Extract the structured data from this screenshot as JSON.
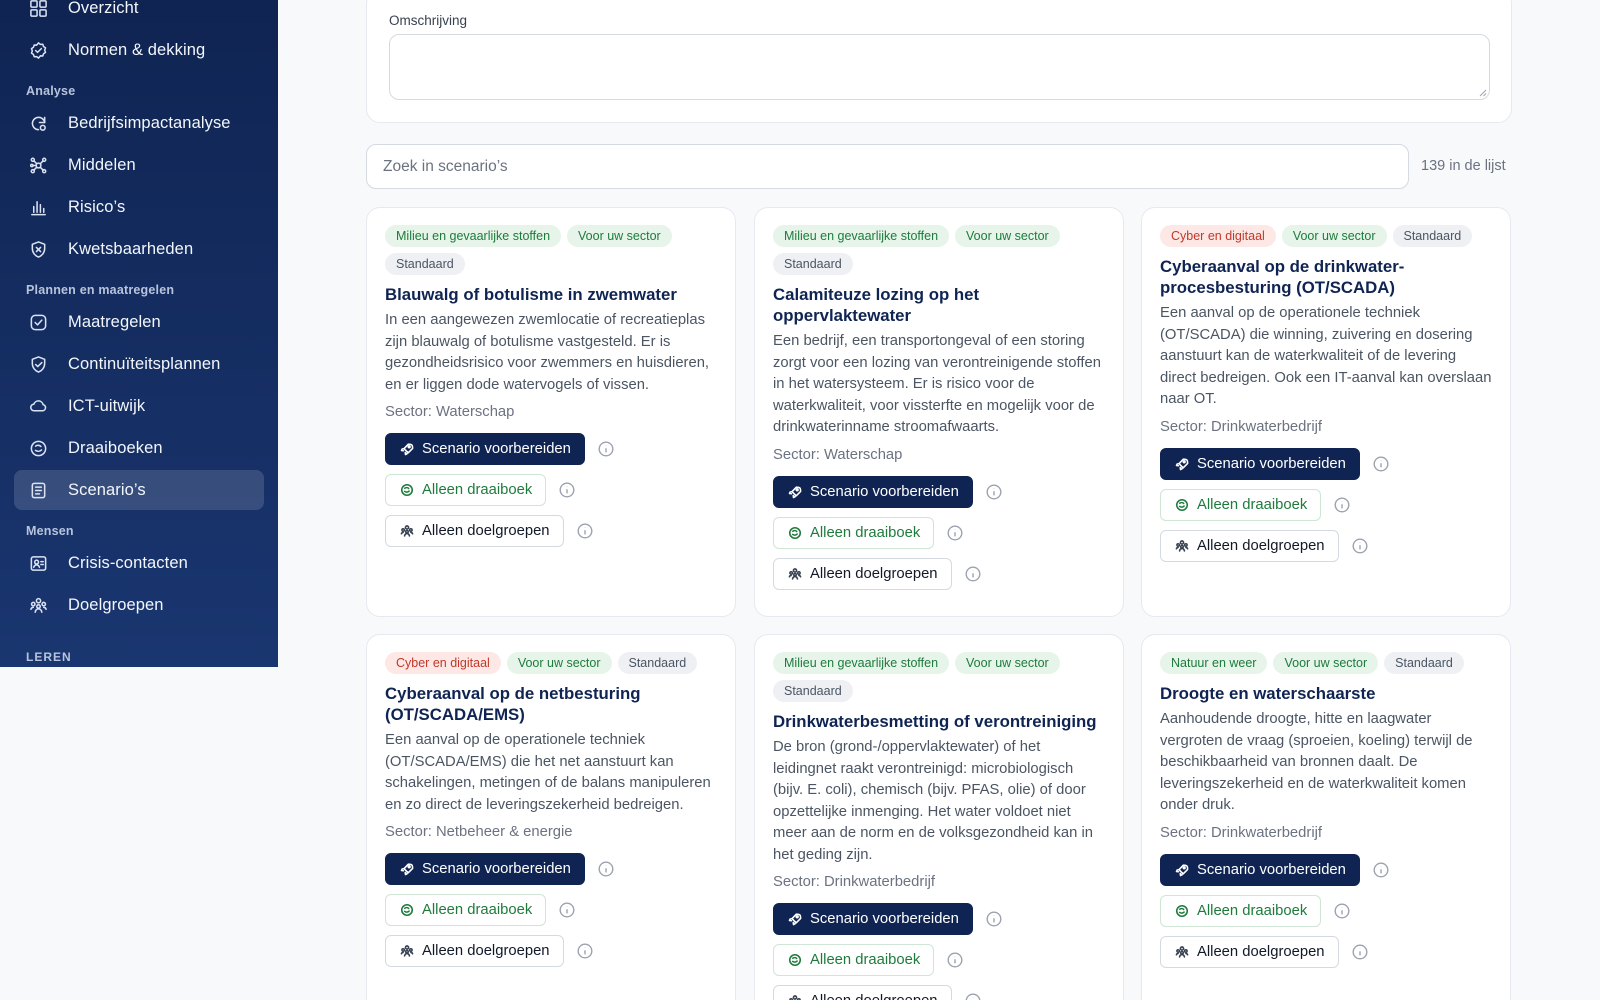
{
  "sidebar": {
    "items": [
      {
        "label": "Overzicht",
        "icon": "grid-icon"
      },
      {
        "label": "Normen & dekking",
        "icon": "badge-check-icon"
      },
      {
        "label": "Bedrijfsimpactanalyse",
        "icon": "refresh-analysis-icon"
      },
      {
        "label": "Middelen",
        "icon": "network-icon"
      },
      {
        "label": "Risico’s",
        "icon": "bar-chart-icon"
      },
      {
        "label": "Kwetsbaarheden",
        "icon": "shield-x-icon"
      },
      {
        "label": "Maatregelen",
        "icon": "check-square-icon"
      },
      {
        "label": "Continuïteitsplannen",
        "icon": "shield-check-icon"
      },
      {
        "label": "ICT-uitwijk",
        "icon": "cloud-icon"
      },
      {
        "label": "Draaiboeken",
        "icon": "book-icon"
      },
      {
        "label": "Scenario’s",
        "icon": "document-icon"
      },
      {
        "label": "Crisis-contacten",
        "icon": "contact-card-icon"
      },
      {
        "label": "Doelgroepen",
        "icon": "users-group-icon"
      }
    ],
    "sections": {
      "analyse": "Analyse",
      "plannen": "Plannen en maatregelen",
      "mensen": "Mensen",
      "leren": "LEREN"
    },
    "active_item": "Scenario’s"
  },
  "description": {
    "label": "Omschrijving",
    "value": ""
  },
  "search": {
    "placeholder": "Zoek in scenario’s",
    "count_text": "139 in de lijst"
  },
  "actions": {
    "prepare": "Scenario voorbereiden",
    "runbook": "Alleen draaiboek",
    "audiences": "Alleen doelgroepen"
  },
  "colors": {
    "sidebar_bg": "#0f2452",
    "primary": "#0f2452",
    "green_badge_text": "#1e7b3c",
    "red_badge_text": "#c0392b"
  },
  "cards": [
    {
      "badges": [
        {
          "text": "Milieu en gevaarlijke stoffen",
          "tone": "green"
        },
        {
          "text": "Voor uw sector",
          "tone": "green"
        },
        {
          "text": "Standaard",
          "tone": "grey"
        }
      ],
      "title": "Blauwalg of botulisme in zwemwater",
      "description": "In een aangewezen zwemlocatie of recreatieplas zijn blauwalg of botulisme vastgesteld. Er is gezondheidsrisico voor zwemmers en huisdieren, en er liggen dode watervogels of vissen.",
      "sector": "Sector: Waterschap"
    },
    {
      "badges": [
        {
          "text": "Milieu en gevaarlijke stoffen",
          "tone": "green"
        },
        {
          "text": "Voor uw sector",
          "tone": "green"
        },
        {
          "text": "Standaard",
          "tone": "grey"
        }
      ],
      "title": "Calamiteuze lozing op het oppervlaktewater",
      "description": "Een bedrijf, een transportongeval of een storing zorgt voor een lozing van verontreinigende stoffen in het watersysteem. Er is risico voor de waterkwaliteit, voor vissterfte en mogelijk voor de drinkwaterinname stroomafwaarts.",
      "sector": "Sector: Waterschap"
    },
    {
      "badges": [
        {
          "text": "Cyber en digitaal",
          "tone": "red"
        },
        {
          "text": "Voor uw sector",
          "tone": "green"
        },
        {
          "text": "Standaard",
          "tone": "grey"
        }
      ],
      "title": "Cyberaanval op de drinkwater-procesbesturing (OT/SCADA)",
      "description": "Een aanval op de operationele techniek (OT/SCADA) die winning, zuivering en dosering aanstuurt kan de waterkwaliteit of de levering direct bedreigen. Ook een IT-aanval kan overslaan naar OT.",
      "sector": "Sector: Drinkwaterbedrijf"
    },
    {
      "badges": [
        {
          "text": "Cyber en digitaal",
          "tone": "red"
        },
        {
          "text": "Voor uw sector",
          "tone": "green"
        },
        {
          "text": "Standaard",
          "tone": "grey"
        }
      ],
      "title": "Cyberaanval op de netbesturing (OT/SCADA/EMS)",
      "description": "Een aanval op de operationele techniek (OT/SCADA/EMS) die het net aanstuurt kan schakelingen, metingen of de balans manipuleren en zo direct de leveringszekerheid bedreigen.",
      "sector": "Sector: Netbeheer & energie"
    },
    {
      "badges": [
        {
          "text": "Milieu en gevaarlijke stoffen",
          "tone": "green"
        },
        {
          "text": "Voor uw sector",
          "tone": "green"
        },
        {
          "text": "Standaard",
          "tone": "grey"
        }
      ],
      "title": "Drinkwaterbesmetting of verontreiniging",
      "description": "De bron (grond-/oppervlaktewater) of het leidingnet raakt verontreinigd: microbiologisch (bijv. E. coli), chemisch (bijv. PFAS, olie) of door opzettelijke inmenging. Het water voldoet niet meer aan de norm en de volksgezondheid kan in het geding zijn.",
      "sector": "Sector: Drinkwaterbedrijf"
    },
    {
      "badges": [
        {
          "text": "Natuur en weer",
          "tone": "green"
        },
        {
          "text": "Voor uw sector",
          "tone": "green"
        },
        {
          "text": "Standaard",
          "tone": "grey"
        }
      ],
      "title": "Droogte en waterschaarste",
      "description": "Aanhoudende droogte, hitte en laagwater vergroten de vraag (sproeien, koeling) terwijl de beschikbaarheid van bronnen daalt. De leveringszekerheid en de waterkwaliteit komen onder druk.",
      "sector": "Sector: Drinkwaterbedrijf"
    }
  ]
}
